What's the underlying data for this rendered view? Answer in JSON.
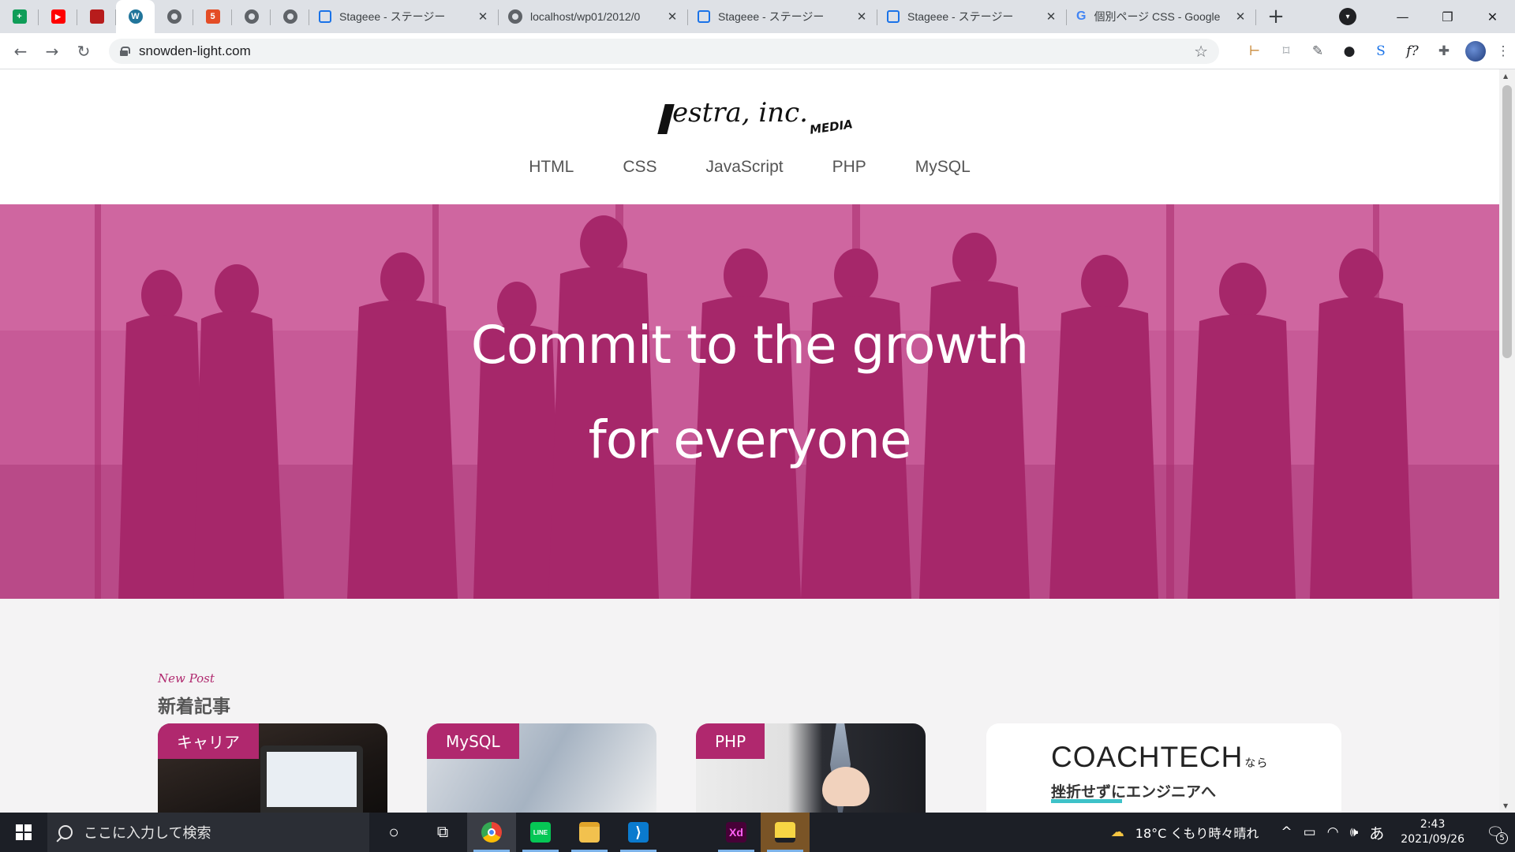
{
  "browser": {
    "pinned_tabs": [
      {
        "icon": "sheets-icon",
        "color": "#0f9d58",
        "glyph": "+"
      },
      {
        "icon": "youtube-icon",
        "color": "#ff0000",
        "glyph": "▶"
      },
      {
        "icon": "book-icon",
        "color": "#b71c1c",
        "glyph": "■"
      },
      {
        "icon": "wordpress-icon",
        "color": "#21759b",
        "glyph": "W"
      },
      {
        "icon": "globe-icon",
        "color": "#5f6368",
        "glyph": ""
      },
      {
        "icon": "html5-icon",
        "color": "#e44d26",
        "glyph": "5"
      },
      {
        "icon": "globe-icon",
        "color": "#5f6368",
        "glyph": ""
      },
      {
        "icon": "globe-icon",
        "color": "#5f6368",
        "glyph": ""
      }
    ],
    "tabs": [
      {
        "title": "Stageee - ステージー",
        "icon": "stageee-icon"
      },
      {
        "title": "localhost/wp01/2012/0",
        "icon": "globe-icon"
      },
      {
        "title": "Stageee - ステージー",
        "icon": "stageee-icon"
      },
      {
        "title": "Stageee - ステージー",
        "icon": "stageee-icon"
      },
      {
        "title": "個別ページ CSS - Google",
        "icon": "google-icon"
      }
    ],
    "new_tab": "+",
    "url": "snowden-light.com",
    "extension_glyph": "f?"
  },
  "site": {
    "logo_text": "estra, inc.",
    "logo_sub": "MEDIA",
    "nav": [
      "HTML",
      "CSS",
      "JavaScript",
      "PHP",
      "MySQL"
    ],
    "hero_line1": "Commit to the growth",
    "hero_line2": "for everyone",
    "section_en": "New Post",
    "section_ja": "新着記事",
    "cards": [
      {
        "category": "キャリア"
      },
      {
        "category": "MySQL"
      },
      {
        "category": "PHP"
      }
    ],
    "ad": {
      "title": "COACHTECH",
      "title_suffix": "なら",
      "subtitle": "挫折せずにエンジニアへ"
    }
  },
  "taskbar": {
    "search_placeholder": "ここに入力して検索",
    "apps": [
      {
        "name": "cortana-icon",
        "glyph": "○",
        "color": "transparent"
      },
      {
        "name": "task-view-icon",
        "glyph": "⧉",
        "color": "transparent"
      },
      {
        "name": "chrome-icon",
        "glyph": "",
        "color": "#34a853"
      },
      {
        "name": "line-icon",
        "glyph": "LINE",
        "color": "#06c755"
      },
      {
        "name": "file-explorer-icon",
        "glyph": "",
        "color": "#f2c14e"
      },
      {
        "name": "vscode-icon",
        "glyph": "⟩",
        "color": "#0a7ace"
      },
      {
        "name": "adobe-xd-icon",
        "glyph": "Xd",
        "color": "#470137"
      },
      {
        "name": "sticky-notes-icon",
        "glyph": "",
        "color": "#f7d544"
      }
    ],
    "weather": "18°C くもり時々晴れ",
    "ime": "あ",
    "time": "2:43",
    "date": "2021/09/26",
    "notifications": "5"
  }
}
